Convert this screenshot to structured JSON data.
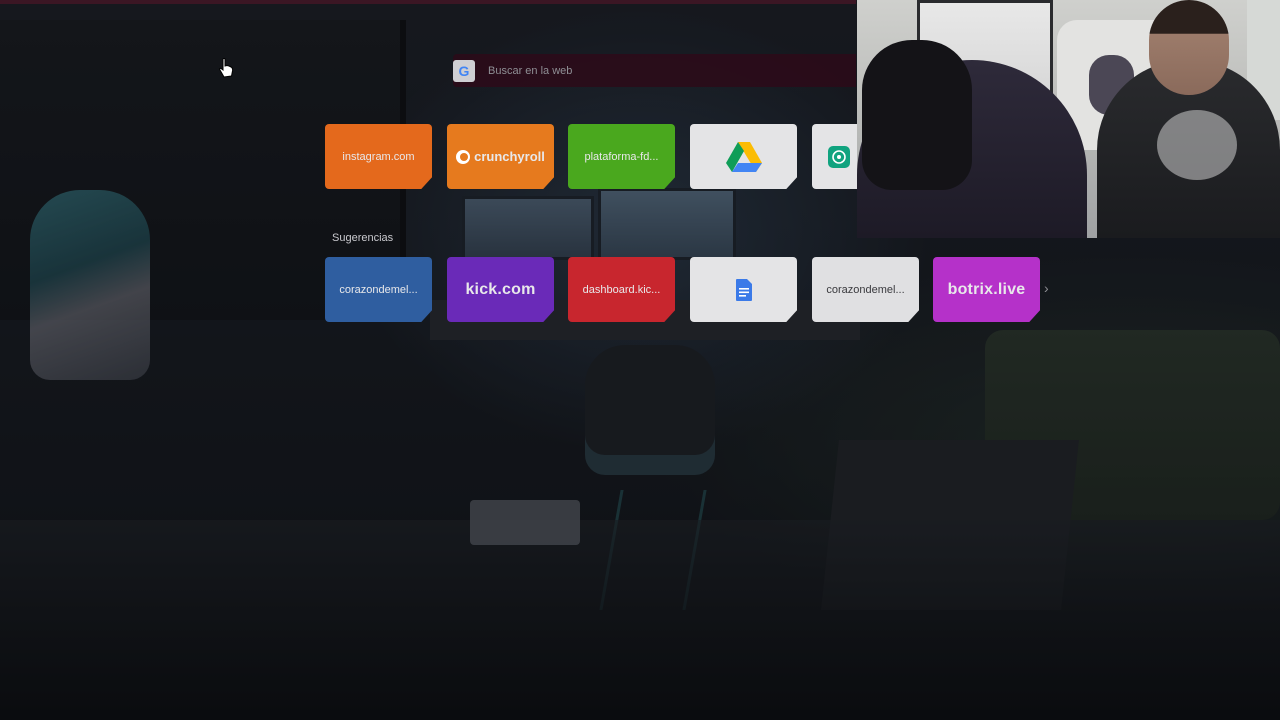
{
  "search": {
    "placeholder": "Buscar en la web",
    "engine_icon": "google-g-icon"
  },
  "shortcuts": [
    {
      "label": "instagram.com",
      "color": "#e4691c"
    },
    {
      "label": "crunchyroll",
      "color": "#e67a1e",
      "icon": "crunchyroll-logo-icon"
    },
    {
      "label": "plataforma-fd...",
      "color": "#4aa81e"
    },
    {
      "label": "",
      "color": "#e4e4e6",
      "icon": "google-drive-icon"
    },
    {
      "label": "",
      "color": "#e4e4e6",
      "icon": "chatgpt-icon"
    }
  ],
  "suggestions_label": "Sugerencias",
  "suggestions": [
    {
      "label": "corazondemel...",
      "color": "#2f5ea0"
    },
    {
      "label": "kick.com",
      "color": "#6a2ab8"
    },
    {
      "label": "dashboard.kic...",
      "color": "#c8262e"
    },
    {
      "label": "",
      "color": "#e4e4e6",
      "icon": "google-docs-icon"
    },
    {
      "label": "corazondemel...",
      "color": "#e0e0e2"
    },
    {
      "label": "botrix.live",
      "color": "#b531c9"
    }
  ],
  "suggestions_next_icon": "chevron-right-icon"
}
